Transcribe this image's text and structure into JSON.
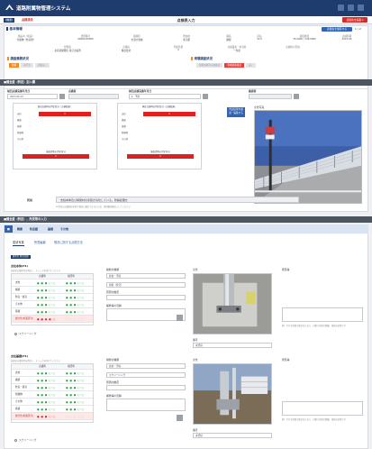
{
  "app": {
    "title": "道路附属物管理システム"
  },
  "page": {
    "kind_badge": "[橋梁]",
    "status_text": "点検済未",
    "title": "点検表入力",
    "edit_button": "点検表を編集 ▾",
    "save_button": "点検表を保存する",
    "page_indicator": "1 / 2"
  },
  "basic": {
    "header": "基本情報",
    "fields": [
      {
        "label": "施設ID（施設）",
        "value": "付属物（防音壁）"
      },
      {
        "label": "管理番号",
        "value": "00000-00000"
      },
      {
        "label": "路線名",
        "value": "市道大池線"
      },
      {
        "label": "所在地",
        "value": "東京都"
      },
      {
        "label": "構造",
        "value": "鋼製"
      },
      {
        "label": "延長",
        "value": "12.0"
      },
      {
        "label": "緯度経度",
        "value": "35.0000 / 139.0000"
      },
      {
        "label": "点検時期",
        "value": "2023.06"
      }
    ],
    "row2": [
      {
        "label": "管理者",
        "value": "北海道開発局 東京出張所"
      },
      {
        "label": "点検員",
        "value": "株式会社"
      },
      {
        "label": "判定結果",
        "value": "Ⅱ"
      },
      {
        "label": "点検業者・担当者",
        "value": "一条達"
      },
      {
        "label": "点検時の天候",
        "value": ""
      }
    ]
  },
  "survey_left": {
    "header": "調査業務状況",
    "steps": [
      "依頼",
      "着手済",
      "調査完了"
    ]
  },
  "survey_right": {
    "header": "現場調査状況",
    "steps": [
      "現場調査済み未確認",
      "現場調査確認",
      "完了"
    ]
  },
  "section1": {
    "bar": "■健全度（判定）記入欄",
    "inspection_date_label": "前回点検実施年月日",
    "inspection_date_value": "2023-06-15",
    "inspector_label": "点検者",
    "inspector_value": "",
    "check_date_label": "前回点検実施年月日",
    "check_date_value": "",
    "check_person_label": "確認者",
    "check_person_value": "",
    "health_label": "健全性",
    "health_value": "Ⅱ：予防",
    "tables": [
      {
        "title": "前回点検時の判定区分（点検結果）",
        "rows": [
          "支柱",
          "横梁",
          "基礎",
          "附属物",
          "その他"
        ],
        "red_row": "Ⅱ"
      },
      {
        "title": "現在点検時の判定区分（点検結果）",
        "rows": [
          "支柱",
          "横梁",
          "基礎",
          "附属物",
          "その他"
        ],
        "red_row": "Ⅱ"
      }
    ],
    "table_left_footer": "施設診断の判定区分",
    "table_right_footer": "施設診断の判定区分",
    "footer_value": "Ⅱ",
    "action_button": "判定結果を確認・編集する",
    "photo_label": "全景写真"
  },
  "note": {
    "label": "所見",
    "value": "支柱本体及び横架材の塗装が劣化している。防錆処理を",
    "help": "※ 所見の記載例は本部で事前に確定できないため、現地確認後記入してください"
  },
  "section2": {
    "bar": "■健全度（判定）、所見等の入力",
    "tabs": [
      "■",
      "概要",
      "防音壁",
      "基礎",
      "その他"
    ],
    "subtabs": [
      "変状写真",
      "所見編纂",
      "現況に関する点検方法"
    ],
    "badge": "健全性 所見記録",
    "part1": {
      "head": "支柱本体(P1)",
      "hint": "各部位の健全性を判定し、チェックを付けてください",
      "col1": "点検時",
      "col2": "前回時",
      "rows": [
        "支柱",
        "横梁",
        "防音・遮音",
        "その他",
        "基礎"
      ],
      "total_label": "健全性(対策区分)",
      "screening": "スクリーニング",
      "select_label": "損傷の種類",
      "select_value": "腐食・汚損",
      "degree_label": "損傷（状況）",
      "degree_value": "損傷（状況）",
      "cause_label": "原因の推定",
      "note_label": "補修等の見解",
      "photo_label": "全景",
      "photo_caption": "番号",
      "photo_sub": "未登録",
      "right_label": "所見等",
      "right_hint": "例）平行な状態で錆が出ており、対策と同様な整備、更新が必要です"
    },
    "part2": {
      "head": "支柱基礎(P1)",
      "hint": "各部位の健全性を判定し、チェックを付けてください",
      "col1": "点検時",
      "col2": "前回時",
      "rows": [
        "支柱",
        "横梁",
        "防音・遮音",
        "附属物",
        "その他",
        "基礎"
      ],
      "total_label": "健全性(対策区分)",
      "screening": "スクリーニング",
      "select_label": "損傷の種類",
      "select_value": "腐食・汚損",
      "degree_label": "損傷（状況）",
      "degree_value": "スクリーニング",
      "cause_label": "原因の推定",
      "note_label": "補修等の見解",
      "photo_label": "全景",
      "photo_caption": "番号",
      "photo_sub": "未登録",
      "right_label": "所見等",
      "right_hint": "例）平行な状態で錆が出ており、対策と同様な整備、更新が必要です"
    }
  },
  "colors": {
    "header": "#1e3d6e",
    "accent_blue": "#2f63b3",
    "alert_red": "#d62b2b",
    "orange": "#f28a25"
  }
}
